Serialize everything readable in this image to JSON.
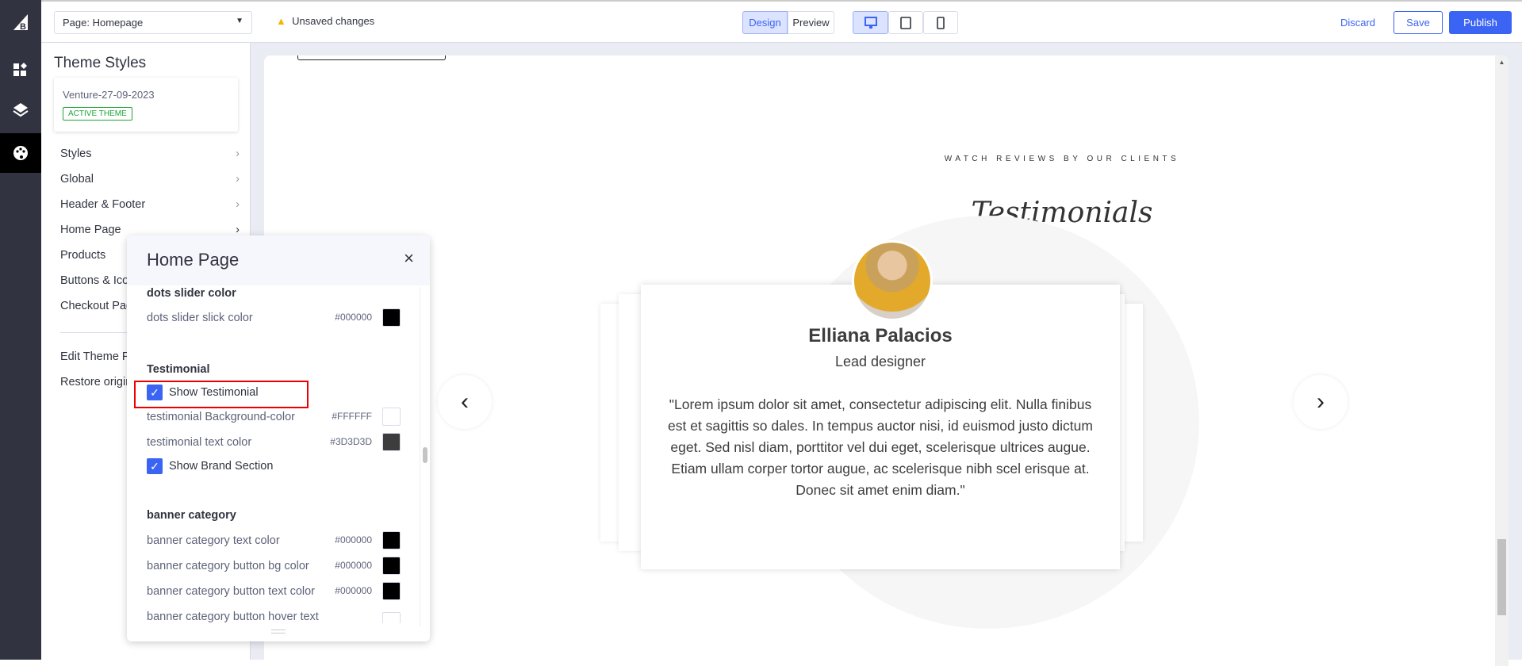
{
  "topbar": {
    "page_select": "Page: Homepage",
    "unsaved": "Unsaved changes",
    "design": "Design",
    "preview": "Preview",
    "discard": "Discard",
    "save": "Save",
    "publish": "Publish",
    "accent": "#3c64f4"
  },
  "sidebar": {
    "title": "Theme Styles",
    "theme_name": "Venture-27-09-2023",
    "active_badge": "ACTIVE THEME",
    "items": [
      {
        "label": "Styles"
      },
      {
        "label": "Global"
      },
      {
        "label": "Header & Footer"
      },
      {
        "label": "Home Page"
      },
      {
        "label": "Products"
      },
      {
        "label": "Buttons & Icons"
      },
      {
        "label": "Checkout Page"
      }
    ],
    "footer_items": [
      {
        "label": "Edit Theme Files"
      },
      {
        "label": "Restore original theme styles"
      }
    ]
  },
  "popup": {
    "title": "Home Page",
    "dots_heading": "dots slider color",
    "dots_label": "dots slider slick color",
    "dots_hex": "#000000",
    "testimonial_heading": "Testimonial",
    "show_testimonial": "Show Testimonial",
    "show_testimonial_checked": true,
    "bg_label": "testimonial Background-color",
    "bg_hex": "#FFFFFF",
    "text_label": "testimonial text color",
    "text_hex": "#3D3D3D",
    "show_brand": "Show Brand Section",
    "show_brand_checked": true,
    "banner_heading": "banner category",
    "banner_rows": [
      {
        "label": "banner category text color",
        "hex": "#000000"
      },
      {
        "label": "banner category button bg color",
        "hex": "#000000"
      },
      {
        "label": "banner category button text color",
        "hex": "#000000"
      },
      {
        "label": "banner category button hover text",
        "hex": ""
      }
    ]
  },
  "preview": {
    "kicker": "WATCH REVIEWS BY OUR CLIENTS",
    "title": "Testimonials",
    "name": "Elliana Palacios",
    "role": "Lead designer",
    "quote": "\"Lorem ipsum dolor sit amet, consectetur adipiscing elit. Nulla finibus est et sagittis so dales. In tempus auctor nisi, id euismod justo dictum eget. Sed nisl diam, porttitor vel dui eget, scelerisque ultrices augue. Etiam ullam corper tortor augue, ac scelerisque nibh scel erisque at. Donec sit amet enim diam.\""
  }
}
